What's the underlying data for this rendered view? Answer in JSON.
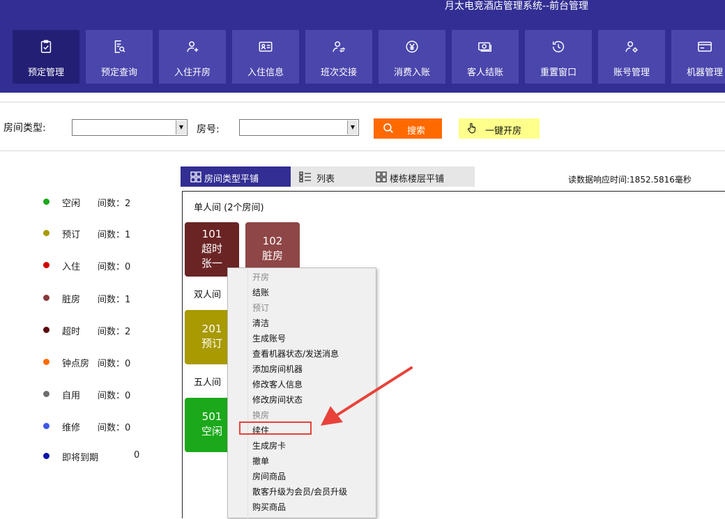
{
  "app": {
    "title": "月太电竞酒店管理系统--前台管理"
  },
  "nav": [
    {
      "label": "预定管理",
      "icon": "clipboard-check-icon"
    },
    {
      "label": "预定查询",
      "icon": "document-search-icon"
    },
    {
      "label": "入住开房",
      "icon": "user-add-icon"
    },
    {
      "label": "入住信息",
      "icon": "id-card-icon"
    },
    {
      "label": "班次交接",
      "icon": "user-swap-icon"
    },
    {
      "label": "消费入账",
      "icon": "yen-circle-icon"
    },
    {
      "label": "客人结账",
      "icon": "cash-icon"
    },
    {
      "label": "重置窗口",
      "icon": "history-icon"
    },
    {
      "label": "账号管理",
      "icon": "user-settings-icon"
    },
    {
      "label": "机器管理",
      "icon": "game-card-icon"
    }
  ],
  "toolbar": {
    "room_type_label": "房间类型:",
    "room_type_value": "",
    "room_no_label": "房号:",
    "room_no_value": "",
    "search_label": "搜索",
    "quick_open_label": "一键开房"
  },
  "legend": [
    {
      "name": "空闲",
      "count": "间数：2",
      "color": "#1BA91B"
    },
    {
      "name": "预订",
      "count": "间数：1",
      "color": "#A89A00"
    },
    {
      "name": "入住",
      "count": "间数：0",
      "color": "#D00000"
    },
    {
      "name": "脏房",
      "count": "间数：1",
      "color": "#8A3A3A"
    },
    {
      "name": "超时",
      "count": "间数：2",
      "color": "#5A0A0A"
    },
    {
      "name": "钟点房",
      "count": "间数：0",
      "color": "#FF6A00"
    },
    {
      "name": "自用",
      "count": "间数：0",
      "color": "#6E6E6E"
    },
    {
      "name": "维修",
      "count": "间数：0",
      "color": "#3F58E8"
    },
    {
      "name": "即将到期",
      "count": "0",
      "color": "#0A14A8"
    }
  ],
  "view_tabs": [
    {
      "label": "房间类型平铺",
      "active": true
    },
    {
      "label": "列表",
      "active": false
    },
    {
      "label": "楼栋楼层平铺",
      "active": false
    }
  ],
  "response_time": "读数据响应时间:1852.5816毫秒",
  "groups": [
    {
      "title": "单人间  (2个房间)"
    },
    {
      "title": "双人间"
    },
    {
      "title": "五人间"
    }
  ],
  "rooms": [
    {
      "number": "101",
      "status": "超时",
      "guest": "张一",
      "color": "#6B2424"
    },
    {
      "number": "102",
      "status": "脏房",
      "guest": "",
      "color": "#8F4646"
    },
    {
      "number": "201",
      "status": "预订",
      "guest": "",
      "color": "#A89A00"
    },
    {
      "number": "501",
      "status": "空闲",
      "guest": "",
      "color": "#1BA91B"
    }
  ],
  "context_menu": [
    {
      "label": "开房",
      "enabled": false
    },
    {
      "label": "结账",
      "enabled": true
    },
    {
      "label": "预订",
      "enabled": false
    },
    {
      "label": "清洁",
      "enabled": true
    },
    {
      "label": "生成账号",
      "enabled": true
    },
    {
      "label": "查看机器状态/发送消息",
      "enabled": true
    },
    {
      "label": "添加房间机器",
      "enabled": true
    },
    {
      "label": "修改客人信息",
      "enabled": true
    },
    {
      "label": "修改房间状态",
      "enabled": true
    },
    {
      "label": "换房",
      "enabled": false
    },
    {
      "label": "续住",
      "enabled": true,
      "highlighted": true
    },
    {
      "label": "生成房卡",
      "enabled": true
    },
    {
      "label": "撤单",
      "enabled": true
    },
    {
      "label": "房间商品",
      "enabled": true
    },
    {
      "label": "散客升级为会员/会员升级",
      "enabled": true
    },
    {
      "label": "购买商品",
      "enabled": true
    }
  ],
  "colors": {
    "header": "#322E93",
    "nav_button": "#4A46AC",
    "nav_active": "#231F75",
    "search": "#FF6A00",
    "quick_open": "#FFFF8C",
    "annotation": "#E8423A"
  }
}
